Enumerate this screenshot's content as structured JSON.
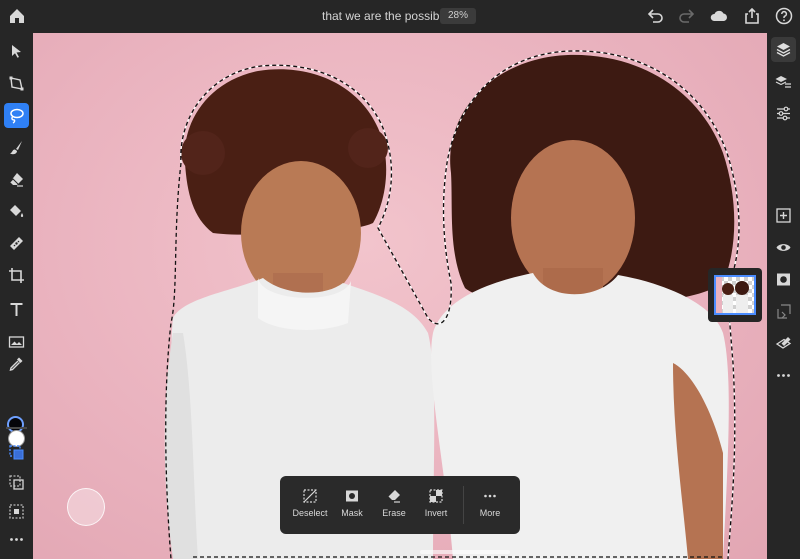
{
  "document": {
    "title": "that we are the possible",
    "zoom": "28%"
  },
  "colors": {
    "accent": "#2f80f5",
    "canvas": "#eab3bf",
    "foreground_color": "#05050a",
    "background_color": "#ffffff"
  },
  "top_icons": [
    "home-icon",
    "undo-icon",
    "redo-icon",
    "cloud-icon",
    "share-icon",
    "help-icon"
  ],
  "left_tools": [
    "select-icon",
    "transform-icon",
    "lasso-icon",
    "brush-icon",
    "eraser-icon",
    "fill-icon",
    "healing-icon",
    "crop-icon",
    "type-icon",
    "place-image-icon",
    "eyedropper-icon"
  ],
  "selection_modes": [
    "new-selection-icon",
    "add-selection-icon",
    "subtract-selection-icon",
    "more-icon"
  ],
  "right_tools": [
    "layers-icon",
    "layer-properties-icon",
    "adjustments-icon",
    "add-layer-icon",
    "visibility-icon",
    "mask-icon",
    "clip-icon",
    "layer-settings-icon",
    "more-icon"
  ],
  "taskbar": {
    "deselect": "Deselect",
    "mask": "Mask",
    "erase": "Erase",
    "invert": "Invert",
    "more": "More"
  }
}
